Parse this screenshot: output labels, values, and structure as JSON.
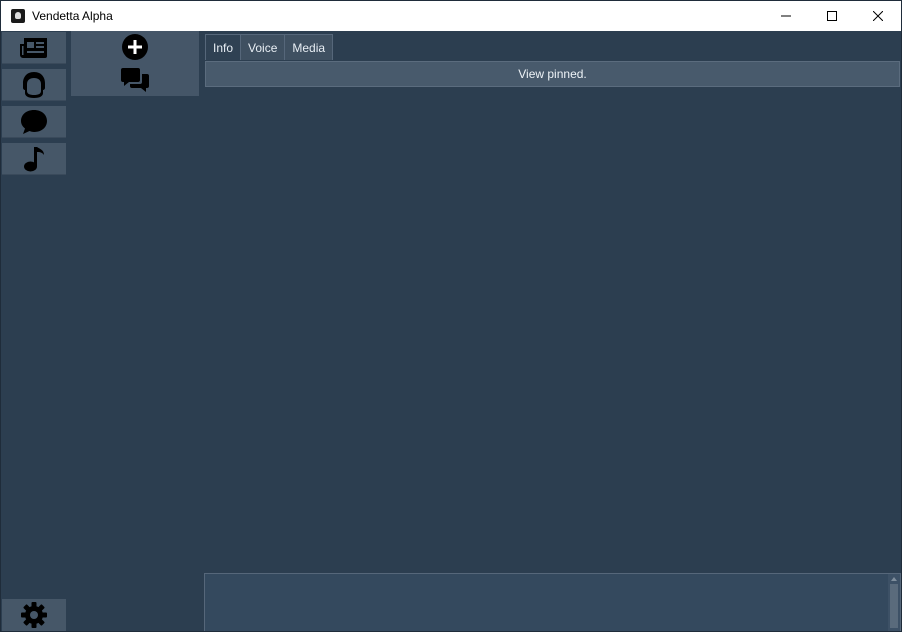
{
  "window": {
    "title": "Vendetta Alpha"
  },
  "rail": {
    "items": [
      {
        "icon": "newspaper-icon",
        "label": "News"
      },
      {
        "icon": "helmet-icon",
        "label": "Profile"
      },
      {
        "icon": "chat-bubble-icon",
        "label": "Chat"
      },
      {
        "icon": "music-note-icon",
        "label": "Music"
      }
    ],
    "settings_icon": "gear-icon"
  },
  "subpanel": {
    "items": [
      {
        "icon": "add-circle-icon"
      },
      {
        "icon": "conversations-icon"
      }
    ]
  },
  "tabs": [
    {
      "label": "Info",
      "active": true
    },
    {
      "label": "Voice",
      "active": false
    },
    {
      "label": "Media",
      "active": false
    }
  ],
  "pinned": {
    "label": "View pinned."
  },
  "composer": {
    "value": ""
  },
  "colors": {
    "background": "#2c3e50",
    "rail_button": "#465768",
    "accent_text": "#eef3f7"
  }
}
